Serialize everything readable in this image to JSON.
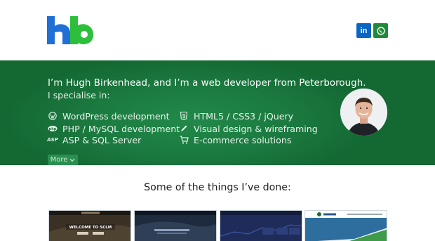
{
  "header": {
    "logo_text": "hb",
    "social": [
      {
        "name": "linkedin",
        "label": "in",
        "color": "#0a66c2"
      },
      {
        "name": "whatsapp",
        "icon": "whatsapp-icon",
        "color": "#1f8a3a"
      }
    ]
  },
  "hero": {
    "title": "I’m Hugh Birkenhead, and I’m a web developer from Peterborough.",
    "subtitle": "I specialise in:",
    "skills_left": [
      {
        "icon": "wordpress-icon",
        "label": "WordPress development"
      },
      {
        "icon": "php-icon",
        "label": "PHP / MySQL development"
      },
      {
        "icon": "asp-icon",
        "label": "ASP & SQL Server"
      }
    ],
    "skills_right": [
      {
        "icon": "html5-icon",
        "label": "HTML5 / CSS3 / jQuery"
      },
      {
        "icon": "pencil-icon",
        "label": "Visual design & wireframing"
      },
      {
        "icon": "cart-icon",
        "label": "E-commerce solutions"
      }
    ],
    "more_label": "More",
    "bg_color": "#1b7a3f"
  },
  "portfolio": {
    "title": "Some of the things I’ve done:",
    "thumb1_heading": "WELCOME TO SCLM"
  }
}
